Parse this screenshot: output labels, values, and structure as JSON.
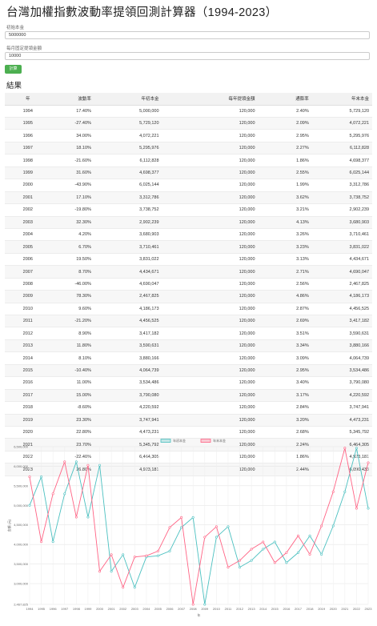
{
  "title": "台灣加權指數波動率提領回測計算器（1994-2023）",
  "form": {
    "initial_label": "初始本金",
    "initial_value": "5000000",
    "withdraw_label": "每月固定提領金額",
    "withdraw_value": "10000",
    "submit_label": "計算"
  },
  "results_heading": "結果",
  "table": {
    "headers": [
      "年",
      "波動率",
      "年初本金",
      "每年提領金額",
      "通膨率",
      "年末本金"
    ],
    "rows": [
      [
        "1994",
        "17.40%",
        "5,000,000",
        "120,000",
        "2.40%",
        "5,729,120"
      ],
      [
        "1995",
        "-27.40%",
        "5,729,120",
        "120,000",
        "2.09%",
        "4,072,221"
      ],
      [
        "1996",
        "34.00%",
        "4,072,221",
        "120,000",
        "2.95%",
        "5,295,976"
      ],
      [
        "1997",
        "18.10%",
        "5,295,976",
        "120,000",
        "2.27%",
        "6,112,828"
      ],
      [
        "1998",
        "-21.60%",
        "6,112,828",
        "120,000",
        "1.86%",
        "4,698,377"
      ],
      [
        "1999",
        "31.60%",
        "4,698,377",
        "120,000",
        "2.55%",
        "6,025,144"
      ],
      [
        "2000",
        "-43.90%",
        "6,025,144",
        "120,000",
        "1.99%",
        "3,312,786"
      ],
      [
        "2001",
        "17.10%",
        "3,312,786",
        "120,000",
        "3.62%",
        "3,738,752"
      ],
      [
        "2002",
        "-19.80%",
        "3,738,752",
        "120,000",
        "3.21%",
        "2,902,239"
      ],
      [
        "2003",
        "32.30%",
        "2,902,239",
        "120,000",
        "4.13%",
        "3,680,903"
      ],
      [
        "2004",
        "4.20%",
        "3,680,903",
        "120,000",
        "3.26%",
        "3,710,461"
      ],
      [
        "2005",
        "6.70%",
        "3,710,461",
        "120,000",
        "3.23%",
        "3,831,022"
      ],
      [
        "2006",
        "19.50%",
        "3,831,022",
        "120,000",
        "3.13%",
        "4,434,671"
      ],
      [
        "2007",
        "8.70%",
        "4,434,671",
        "120,000",
        "2.71%",
        "4,690,047"
      ],
      [
        "2008",
        "-46.00%",
        "4,690,047",
        "120,000",
        "2.56%",
        "2,467,825"
      ],
      [
        "2009",
        "78.30%",
        "2,467,825",
        "120,000",
        "4.86%",
        "4,186,173"
      ],
      [
        "2010",
        "9.60%",
        "4,186,173",
        "120,000",
        "2.87%",
        "4,456,525"
      ],
      [
        "2011",
        "-21.20%",
        "4,456,525",
        "120,000",
        "2.69%",
        "3,417,182"
      ],
      [
        "2012",
        "8.90%",
        "3,417,182",
        "120,000",
        "3.51%",
        "3,590,631"
      ],
      [
        "2013",
        "11.80%",
        "3,590,631",
        "120,000",
        "3.34%",
        "3,880,166"
      ],
      [
        "2014",
        "8.10%",
        "3,880,166",
        "120,000",
        "3.09%",
        "4,064,739"
      ],
      [
        "2015",
        "-10.40%",
        "4,064,739",
        "120,000",
        "2.95%",
        "3,534,486"
      ],
      [
        "2016",
        "11.00%",
        "3,534,486",
        "120,000",
        "3.40%",
        "3,790,080"
      ],
      [
        "2017",
        "15.00%",
        "3,790,080",
        "120,000",
        "3.17%",
        "4,220,592"
      ],
      [
        "2018",
        "-8.60%",
        "4,220,592",
        "120,000",
        "2.84%",
        "3,747,941"
      ],
      [
        "2019",
        "23.30%",
        "3,747,941",
        "120,000",
        "3.20%",
        "4,473,231"
      ],
      [
        "2020",
        "22.80%",
        "4,473,231",
        "120,000",
        "2.68%",
        "5,345,792"
      ],
      [
        "2021",
        "23.70%",
        "5,345,792",
        "120,000",
        "2.24%",
        "6,464,305"
      ],
      [
        "2022",
        "-22.40%",
        "6,464,305",
        "120,000",
        "1.86%",
        "4,923,181"
      ],
      [
        "2023",
        "26.80%",
        "4,923,181",
        "120,000",
        "2.44%",
        "6,090,433"
      ]
    ]
  },
  "chart_data": {
    "type": "line",
    "x": [
      "1994",
      "1995",
      "1996",
      "1997",
      "1998",
      "1999",
      "2000",
      "2001",
      "2002",
      "2003",
      "2004",
      "2005",
      "2006",
      "2007",
      "2008",
      "2009",
      "2010",
      "2011",
      "2012",
      "2013",
      "2014",
      "2015",
      "2016",
      "2017",
      "2018",
      "2019",
      "2020",
      "2021",
      "2022",
      "2023"
    ],
    "series": [
      {
        "name": "年初本金",
        "color": "#4bc0c0",
        "values": [
          5000000,
          5729120,
          4072221,
          5295976,
          6112828,
          4698377,
          6025144,
          3312786,
          3738752,
          2902239,
          3680903,
          3710461,
          3831022,
          4434671,
          4690047,
          2467825,
          4186173,
          4456525,
          3417182,
          3590631,
          3880166,
          4064739,
          3534486,
          3790080,
          4220592,
          3747941,
          4473231,
          5345792,
          6464305,
          4923181
        ]
      },
      {
        "name": "年末本金",
        "color": "#ff6384",
        "values": [
          5729120,
          4072221,
          5295976,
          6112828,
          4698377,
          6025144,
          3312786,
          3738752,
          2902239,
          3680903,
          3710461,
          3831022,
          4434671,
          4690047,
          2467825,
          4186173,
          4456525,
          3417182,
          3590631,
          3880166,
          4064739,
          3534486,
          3790080,
          4220592,
          3747941,
          4473231,
          5345792,
          6464305,
          4923181,
          6090433
        ]
      }
    ],
    "y_ticks": [
      "2,467,825",
      "3,000,000",
      "3,500,000",
      "4,000,000",
      "4,500,000",
      "5,000,000",
      "5,500,000",
      "6,000,000",
      "6,500,000"
    ],
    "ylim": [
      2467825,
      6500000
    ],
    "xlabel": "年",
    "ylabel": "金額 (元)",
    "legend": "top-center",
    "grid": true
  }
}
